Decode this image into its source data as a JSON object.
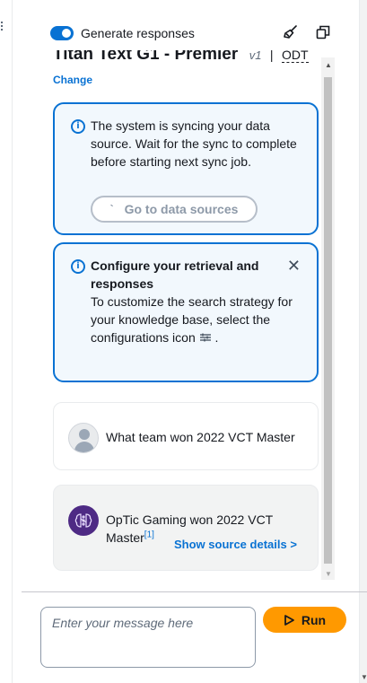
{
  "header": {
    "toggle_label": "Generate responses",
    "toggle_on": true,
    "icons": [
      "broom-icon",
      "copy-icon"
    ]
  },
  "model": {
    "name": "Titan Text G1 - Premier",
    "version": "v1",
    "separator": "|",
    "throughput": "ODT",
    "change_link": "Change"
  },
  "sync_alert": {
    "icon": "info-icon",
    "text": "The system is syncing your data source. Wait for the sync to complete before starting next sync job.",
    "button_label": "Go to data sources",
    "button_disabled": true
  },
  "config_alert": {
    "icon": "info-icon",
    "heading": "Configure your retrieval and responses",
    "body_text": "To customize the search strategy for your knowledge base, select the configurations icon",
    "body_suffix": "."
  },
  "conversation": {
    "user_message": "What team won 2022 VCT Master",
    "bot_message": "OpTic Gaming won 2022 VCT Master",
    "citation": "[1]",
    "source_link": "Show source details >"
  },
  "composer": {
    "placeholder": "Enter your message here",
    "run_label": "Run"
  },
  "colors": {
    "accent": "#0972d3",
    "run_button": "#ff9900",
    "alert_bg": "#f2f8fd"
  }
}
